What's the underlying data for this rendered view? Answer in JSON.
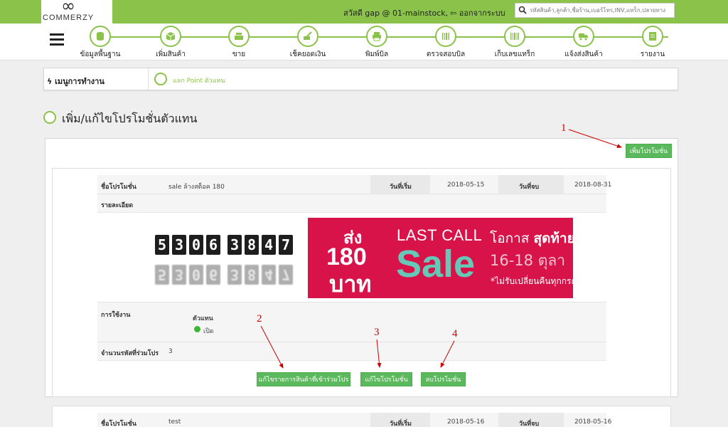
{
  "topbar": {
    "logo_mark": "∞",
    "logo_name": "COMMERZY",
    "greeting": "สวัสดี gap @ 01-mainstock,",
    "logout": "ออกจากระบบ",
    "search_placeholder": "รหัสสินค้า,ลูกค้า,ชื่อร้าน,เบอร์โทร,INV,แทร็ก,ปลายทาง"
  },
  "nav": {
    "items": [
      {
        "label": "ข้อมูลพื้นฐาน",
        "icon": "database-icon"
      },
      {
        "label": "เพิ่มสินค้า",
        "icon": "box-icon"
      },
      {
        "label": "ขาย",
        "icon": "cash-register-icon"
      },
      {
        "label": "เช็คยอดเงิน",
        "icon": "money-check-icon"
      },
      {
        "label": "พิมพ์บิล",
        "icon": "printer-icon"
      },
      {
        "label": "ตรวจสอบบิล",
        "icon": "barcode-scan-icon"
      },
      {
        "label": "เก็บเลขแทร็ก",
        "icon": "barcode-scanner-icon"
      },
      {
        "label": "แจ้งส่งสินค้า",
        "icon": "truck-icon"
      },
      {
        "label": "รายงาน",
        "icon": "report-icon"
      }
    ]
  },
  "menu": {
    "title": "เมนูการทำงาน",
    "link": "แลก Point ตัวแทน"
  },
  "page": {
    "title": "เพิ่ม/แก้ไขโปรโมชั่นตัวแทน",
    "add_button": "เพิ่มโปรโมชั่น"
  },
  "promo1": {
    "name_label": "ชื่อโปรโมชั่น",
    "name": "sale ล้างสต็อค 180",
    "start_label": "วันที่เริ่ม",
    "start": "2018-05-15",
    "end_label": "วันที่จบ",
    "end": "2018-08-31",
    "detail_label": "รายละเอียด",
    "usage_label": "การใช้งาน",
    "usage_type": "ตัวแทน",
    "usage_status": "เปิด",
    "count_label": "จำนวนรหัสที่ร่วมโปร",
    "count": "3",
    "btn_edit_items": "แก้ไขรายการสินค้าที่เข้าร่วมโปร",
    "btn_edit": "แก้ไขโปรโมชั่น",
    "btn_delete": "ลบโปรโมชั่น"
  },
  "banner": {
    "digits": [
      "5",
      "3",
      "0",
      "6",
      "3",
      "8",
      "4",
      "7"
    ],
    "song": "ส่ง",
    "amount": "180",
    "baht": "บาท",
    "last_call": "LAST CALL",
    "sale": "Sale",
    "chance": "โอกาส",
    "chance_bold": "สุดท้าย",
    "dates": "16-18 ตุลา",
    "note": "*ไม่รับเปลี่ยนคืนทุกกรณี"
  },
  "promo2": {
    "name_label": "ชื่อโปรโมชั่น",
    "name": "test",
    "start_label": "วันที่เริ่ม",
    "start": "2018-05-16",
    "end_label": "วันที่จบ",
    "end": "2018-05-16"
  },
  "annotations": [
    "1",
    "2",
    "3",
    "4"
  ],
  "colors": {
    "accent": "#8bc34a",
    "button": "#5cb85c",
    "banner": "#d7134a",
    "annotation": "#cc0000"
  }
}
